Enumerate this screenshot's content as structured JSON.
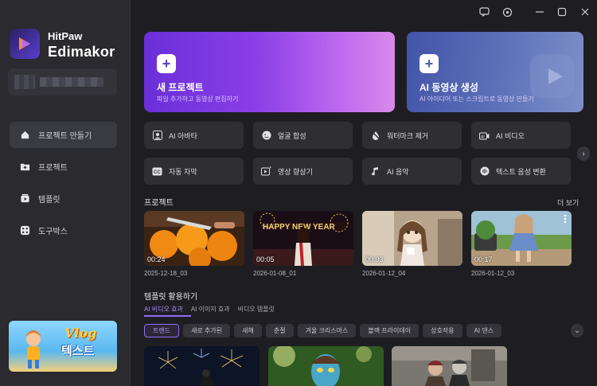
{
  "app": {
    "brand_line1": "HitPaw",
    "brand_line2": "Edimakor"
  },
  "sidebar": {
    "items": [
      {
        "label": "프로젝트 만들기",
        "icon": "home-icon",
        "active": true
      },
      {
        "label": "프로젝트",
        "icon": "folder-plus-icon",
        "active": false
      },
      {
        "label": "템플릿",
        "icon": "template-icon",
        "active": false
      },
      {
        "label": "도구박스",
        "icon": "toolbox-icon",
        "active": false
      }
    ],
    "promo": {
      "title": "Vlog",
      "subtitle": "텍스트"
    }
  },
  "titlebar": {
    "icons": [
      "feedback-icon",
      "settings-icon",
      "minimize-icon",
      "maximize-icon",
      "close-icon"
    ]
  },
  "cards": {
    "new_project": {
      "title": "새 프로젝트",
      "subtitle": "파일 추가하고 동영상 편집하기"
    },
    "ai_video": {
      "title": "AI 동영상 생성",
      "subtitle": "AI 아이디어 또는 스크립트로 동영상 만들기"
    }
  },
  "tools": [
    {
      "label": "AI 아바타",
      "icon": "avatar-icon"
    },
    {
      "label": "얼굴 합성",
      "icon": "face-swap-icon"
    },
    {
      "label": "워터마크 제거",
      "icon": "watermark-remove-icon"
    },
    {
      "label": "AI 비디오",
      "icon": "ai-video-icon"
    },
    {
      "label": "자동 자막",
      "icon": "caption-icon"
    },
    {
      "label": "영상 향상기",
      "icon": "video-enhance-icon"
    },
    {
      "label": "AI 음악",
      "icon": "music-icon"
    },
    {
      "label": "텍스트 음성 변환",
      "icon": "tts-icon"
    }
  ],
  "projects": {
    "title": "프로젝트",
    "more": "더 보기",
    "items": [
      {
        "name": "2025-12-18_03",
        "duration": "00:24"
      },
      {
        "name": "2026-01-08_01",
        "duration": "00:05"
      },
      {
        "name": "2026-01-12_04",
        "duration": "00:03"
      },
      {
        "name": "2026-01-12_03",
        "duration": "00:17"
      }
    ]
  },
  "templates": {
    "title": "템플릿 활용하기",
    "tabs": [
      "AI 비디오 효과",
      "AI 이미지 효과",
      "비디오 템플릿"
    ],
    "chips": [
      "트렌드",
      "새로 추가된",
      "새해",
      "춘절",
      "겨울 크리스마스",
      "블랙 프라이데이",
      "상호작용",
      "AI 댄스"
    ]
  }
}
